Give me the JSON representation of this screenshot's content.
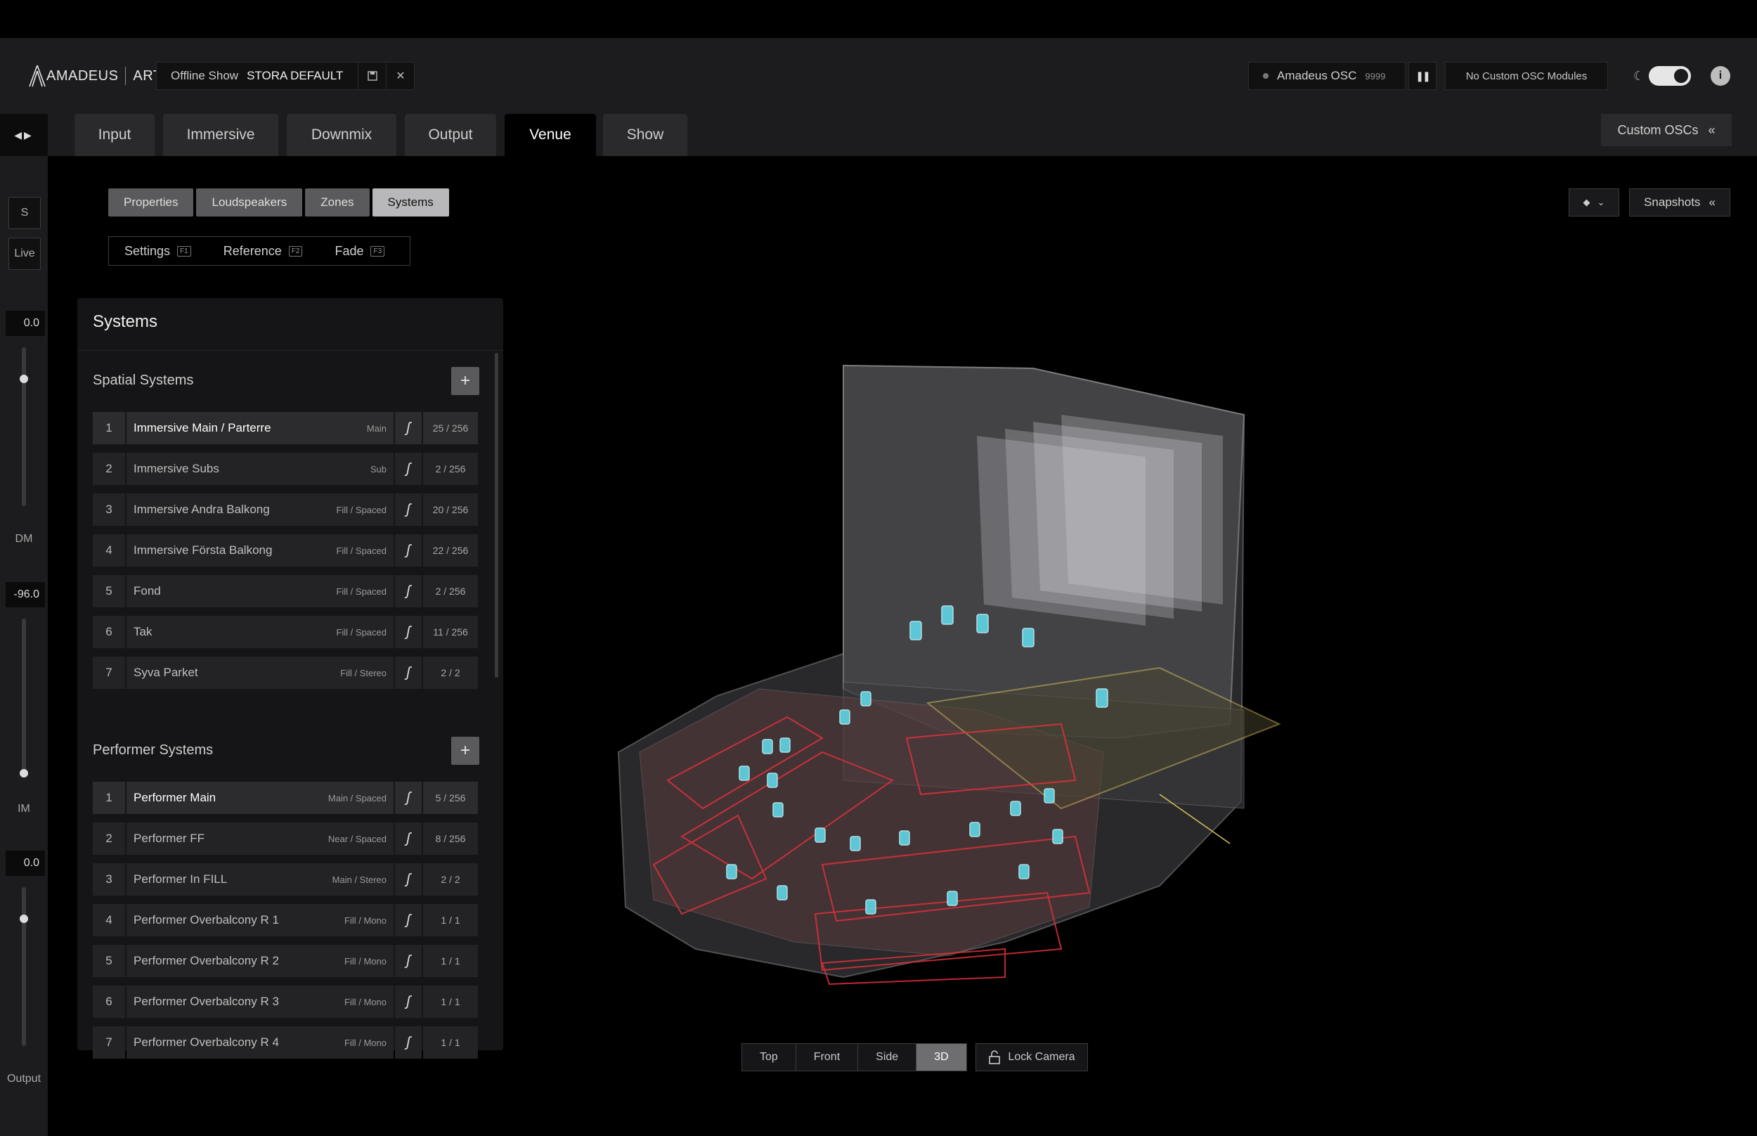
{
  "app": {
    "brand": "AMADEUS",
    "product": "ART"
  },
  "show": {
    "label": "Offline Show",
    "name": "STORA DEFAULT"
  },
  "osc": {
    "name": "Amadeus OSC",
    "port": "9999",
    "custom_modules": "No Custom OSC Modules"
  },
  "tabs": [
    "Input",
    "Immersive",
    "Downmix",
    "Output",
    "Venue",
    "Show"
  ],
  "active_tab": "Venue",
  "custom_oscs_label": "Custom OSCs",
  "rail": {
    "s_label": "S",
    "live_label": "Live",
    "dm_value": "0.0",
    "dm_label": "DM",
    "dm_level": 0.82,
    "im_value": "-96.0",
    "im_label": "IM",
    "im_level": 0.0,
    "out_value": "0.0",
    "out_label": "Output",
    "out_level": 0.82
  },
  "subtabs": [
    "Properties",
    "Loudspeakers",
    "Zones",
    "Systems"
  ],
  "active_subtab": "Systems",
  "modes": [
    {
      "label": "Settings",
      "key": "F1"
    },
    {
      "label": "Reference",
      "key": "F2"
    },
    {
      "label": "Fade",
      "key": "F3"
    }
  ],
  "snapshots_label": "Snapshots",
  "panel": {
    "title": "Systems",
    "spatial_title": "Spatial Systems",
    "performer_title": "Performer Systems",
    "spatial": [
      {
        "num": "1",
        "name": "Immersive Main / Parterre",
        "type": "Main",
        "count": "25 / 256"
      },
      {
        "num": "2",
        "name": "Immersive Subs",
        "type": "Sub",
        "count": "2 / 256"
      },
      {
        "num": "3",
        "name": "Immersive Andra Balkong",
        "type": "Fill / Spaced",
        "count": "20 / 256"
      },
      {
        "num": "4",
        "name": "Immersive Första Balkong",
        "type": "Fill / Spaced",
        "count": "22 / 256"
      },
      {
        "num": "5",
        "name": "Fond",
        "type": "Fill / Spaced",
        "count": "2 / 256"
      },
      {
        "num": "6",
        "name": "Tak",
        "type": "Fill / Spaced",
        "count": "11 / 256"
      },
      {
        "num": "7",
        "name": "Syva Parket",
        "type": "Fill / Stereo",
        "count": "2 / 2"
      }
    ],
    "performer": [
      {
        "num": "1",
        "name": "Performer Main",
        "type": "Main / Spaced",
        "count": "5 / 256"
      },
      {
        "num": "2",
        "name": "Performer FF",
        "type": "Near / Spaced",
        "count": "8 / 256"
      },
      {
        "num": "3",
        "name": "Performer In FILL",
        "type": "Main / Stereo",
        "count": "2 / 2"
      },
      {
        "num": "4",
        "name": "Performer Overbalcony R 1",
        "type": "Fill / Mono",
        "count": "1 / 1"
      },
      {
        "num": "5",
        "name": "Performer Overbalcony R 2",
        "type": "Fill / Mono",
        "count": "1 / 1"
      },
      {
        "num": "6",
        "name": "Performer Overbalcony R 3",
        "type": "Fill / Mono",
        "count": "1 / 1"
      },
      {
        "num": "7",
        "name": "Performer Overbalcony R 4",
        "type": "Fill / Mono",
        "count": "1 / 1"
      }
    ]
  },
  "views": [
    "Top",
    "Front",
    "Side",
    "3D"
  ],
  "active_view": "3D",
  "lock_camera_label": "Lock Camera",
  "colors": {
    "zone": "#e0303a",
    "speaker": "#5fd6e6",
    "stage": "#d8c25a"
  }
}
